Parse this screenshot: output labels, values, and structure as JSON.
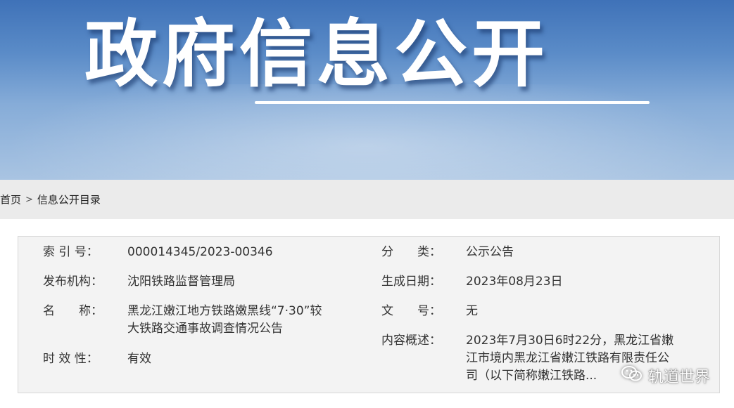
{
  "banner": {
    "title": "政府信息公开"
  },
  "breadcrumb": {
    "home": "首页",
    "separator": ">",
    "current": "信息公开目录"
  },
  "info": {
    "index_label": "索 引 号：",
    "index_value": "000014345/2023-00346",
    "category_label": "分　　类：",
    "category_value": "公示公告",
    "publisher_label": "发布机构：",
    "publisher_value": "沈阳铁路监督管理局",
    "date_label": "生成日期：",
    "date_value": "2023年08月23日",
    "name_label": "名　　称：",
    "name_value_line1": "黑龙江嫩江地方铁路嫩黑线“7·30”较",
    "name_value_line2": "大铁路交通事故调查情况公告",
    "doc_no_label": "文　　号：",
    "doc_no_value": "无",
    "summary_label": "内容概述：",
    "summary_line1": "2023年7月30日6时22分，黑龙江省嫩",
    "summary_line2": "江市境内黑龙江省嫩江铁路有限责任公",
    "summary_line3": "司（以下简称嫩江铁路...",
    "validity_label": "时 效 性：",
    "validity_value": "有效"
  },
  "watermark": {
    "text": "轨道世界",
    "icon": "wechat-icon"
  }
}
